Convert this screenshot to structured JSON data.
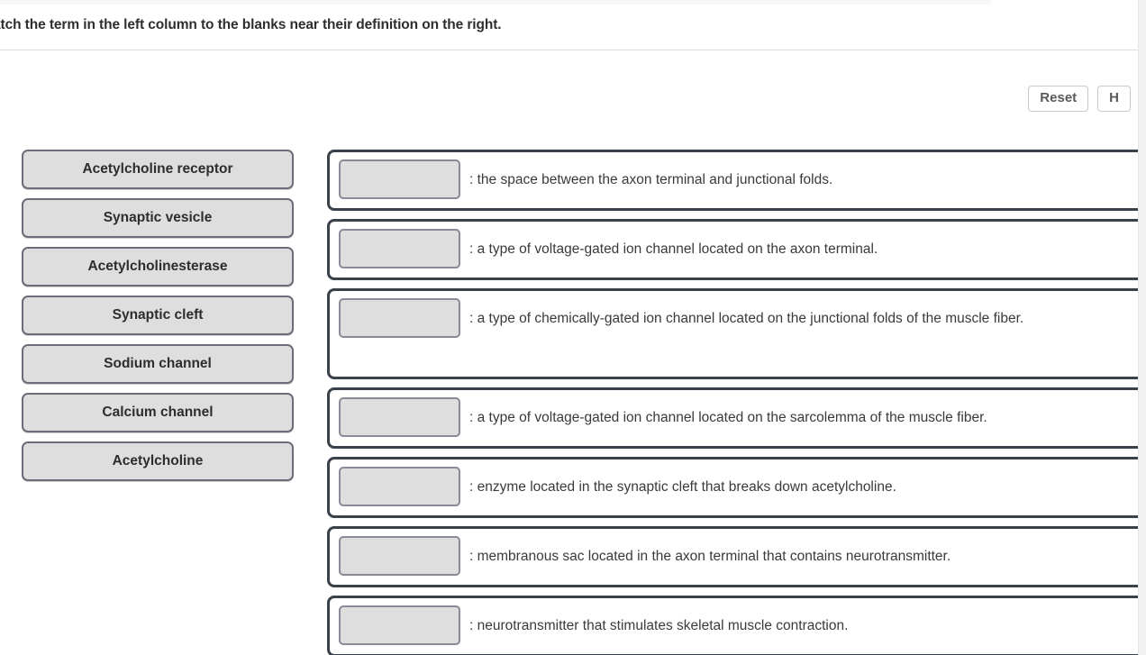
{
  "instructions": {
    "prompt": "atch the term in the left column to the blanks near their definition on the right."
  },
  "toolbar": {
    "reset_label": "Reset",
    "help_label": "H"
  },
  "terms": [
    {
      "label": "Acetylcholine receptor"
    },
    {
      "label": "Synaptic vesicle"
    },
    {
      "label": "Acetylcholinesterase"
    },
    {
      "label": "Synaptic cleft"
    },
    {
      "label": "Sodium channel"
    },
    {
      "label": "Calcium channel"
    },
    {
      "label": "Acetylcholine"
    }
  ],
  "definitions": [
    {
      "slot_value": "",
      "text": ": the space between the axon terminal and junctional folds."
    },
    {
      "slot_value": "",
      "text": ": a type of voltage-gated ion channel located on the axon terminal."
    },
    {
      "slot_value": "",
      "text": ": a type of chemically-gated ion channel located on the junctional folds of the muscle fiber."
    },
    {
      "slot_value": "",
      "text": ": a type of voltage-gated ion channel located on the sarcolemma of the muscle fiber."
    },
    {
      "slot_value": "",
      "text": ": enzyme located in the synaptic cleft that breaks down acetylcholine."
    },
    {
      "slot_value": "",
      "text": ": membranous sac located in the axon terminal that contains neurotransmitter."
    },
    {
      "slot_value": "",
      "text": ": neurotransmitter that stimulates skeletal muscle contraction."
    }
  ],
  "colors": {
    "tile_fill": "#dedede",
    "tile_border": "#6d6d7a",
    "row_border": "#39414a",
    "text": "#3a3a3a",
    "page_background": "#ffffff",
    "gutter": "#f2f2f2"
  }
}
